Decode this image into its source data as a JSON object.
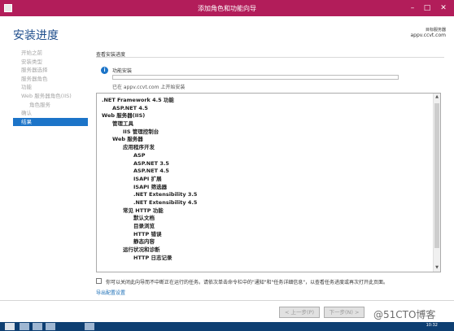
{
  "window": {
    "title": "添加角色和功能向导",
    "min_icon": "minimize-icon",
    "max_icon": "maximize-icon",
    "close_icon": "close-icon"
  },
  "header": {
    "heading": "安装进度",
    "server_label": "目标服务器",
    "server_name": "appv.ccvt.com"
  },
  "sidebar": {
    "items": [
      {
        "label": "开始之前",
        "active": false,
        "sub": false
      },
      {
        "label": "安装类型",
        "active": false,
        "sub": false
      },
      {
        "label": "服务器选择",
        "active": false,
        "sub": false
      },
      {
        "label": "服务器角色",
        "active": false,
        "sub": false
      },
      {
        "label": "功能",
        "active": false,
        "sub": false
      },
      {
        "label": "Web 服务器角色(IIS)",
        "active": false,
        "sub": false
      },
      {
        "label": "角色服务",
        "active": false,
        "sub": true
      },
      {
        "label": "确认",
        "active": false,
        "sub": false
      },
      {
        "label": "结果",
        "active": true,
        "sub": false
      }
    ]
  },
  "main": {
    "section_label": "查看安装进度",
    "progress": {
      "icon": "info-icon",
      "status": "功能安装",
      "value": 0,
      "note": "已在 appv.ccvt.com 上开始安装"
    },
    "features": [
      {
        "label": ".NET Framework 4.5 功能",
        "level": 0
      },
      {
        "label": "ASP.NET 4.5",
        "level": 1
      },
      {
        "label": "Web 服务器(IIS)",
        "level": 0
      },
      {
        "label": "管理工具",
        "level": 1
      },
      {
        "label": "IIS 管理控制台",
        "level": 2
      },
      {
        "label": "Web 服务器",
        "level": 1
      },
      {
        "label": "应用程序开发",
        "level": 2
      },
      {
        "label": "ASP",
        "level": 3
      },
      {
        "label": "ASP.NET 3.5",
        "level": 3
      },
      {
        "label": "ASP.NET 4.5",
        "level": 3
      },
      {
        "label": "ISAPI 扩展",
        "level": 3
      },
      {
        "label": "ISAPI 筛选器",
        "level": 3
      },
      {
        "label": ".NET Extensibility 3.5",
        "level": 3
      },
      {
        "label": ".NET Extensibility 4.5",
        "level": 3
      },
      {
        "label": "常见 HTTP 功能",
        "level": 2
      },
      {
        "label": "默认文档",
        "level": 3
      },
      {
        "label": "目录浏览",
        "level": 3
      },
      {
        "label": "HTTP 错误",
        "level": 3
      },
      {
        "label": "静态内容",
        "level": 3
      },
      {
        "label": "运行状况和诊断",
        "level": 2
      },
      {
        "label": "HTTP 日志记录",
        "level": 3
      }
    ],
    "notice": "你可以关闭此向导而不中断正在运行的任务。请依次单击命令栏中的\"通知\"和\"任务详细信息\"，以查看任务进度或再次打开此页面。",
    "export_link": "导出配置设置"
  },
  "footer": {
    "prev_label": "< 上一步(P)",
    "next_label": "下一步(N) >"
  },
  "taskbar": {
    "clock": "10:32"
  },
  "watermark": "@51CTO博客",
  "colors": {
    "titlebar": "#b21d5a",
    "accent": "#1c74c8",
    "heading": "#1f4e8c"
  }
}
